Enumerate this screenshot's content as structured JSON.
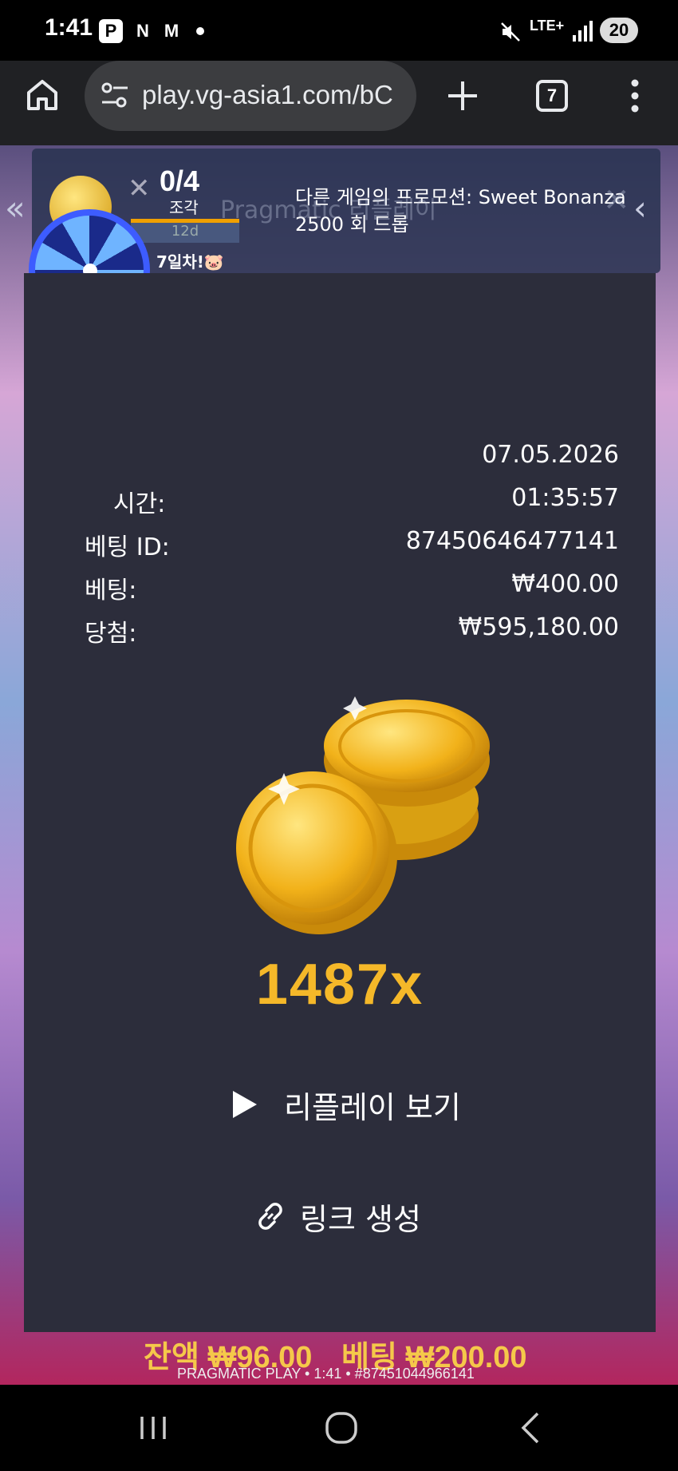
{
  "status_bar": {
    "time": "1:41",
    "notif_icons": [
      "P",
      "N",
      "M"
    ],
    "network": "LTE+",
    "battery": "20"
  },
  "browser": {
    "url": "play.vg-asia1.com/bC",
    "tab_count": "7"
  },
  "promo": {
    "text": "다른 게임의 프로모션: Sweet Bonanza 2500 회 드롭",
    "piece_count": "0/4",
    "piece_label": "조각",
    "timer": "12d",
    "streak": "7일차!🐷",
    "overlay_title": "Pragmatic 리플레이"
  },
  "bet_details": {
    "rows": [
      {
        "label": "",
        "value": "07.05.2026"
      },
      {
        "label": "시간:",
        "value": "01:35:57"
      },
      {
        "label": "베팅 ID:",
        "value": "87450646477141"
      },
      {
        "label": "베팅:",
        "value": "₩400.00"
      },
      {
        "label": "당첨:",
        "value": "₩595,180.00"
      }
    ]
  },
  "multiplier": "1487x",
  "actions": {
    "replay_label": "리플레이 보기",
    "link_label": "링크 생성"
  },
  "game_footer": {
    "balance": "잔액 ₩96.00",
    "bet": "베팅 ₩200.00",
    "info": "PRAGMATIC PLAY • 1:41 • #87451044966141"
  },
  "colors": {
    "panel_bg": "#2c2d3b",
    "multiplier": "#f5b829",
    "accent_gold": "#f0c020"
  }
}
